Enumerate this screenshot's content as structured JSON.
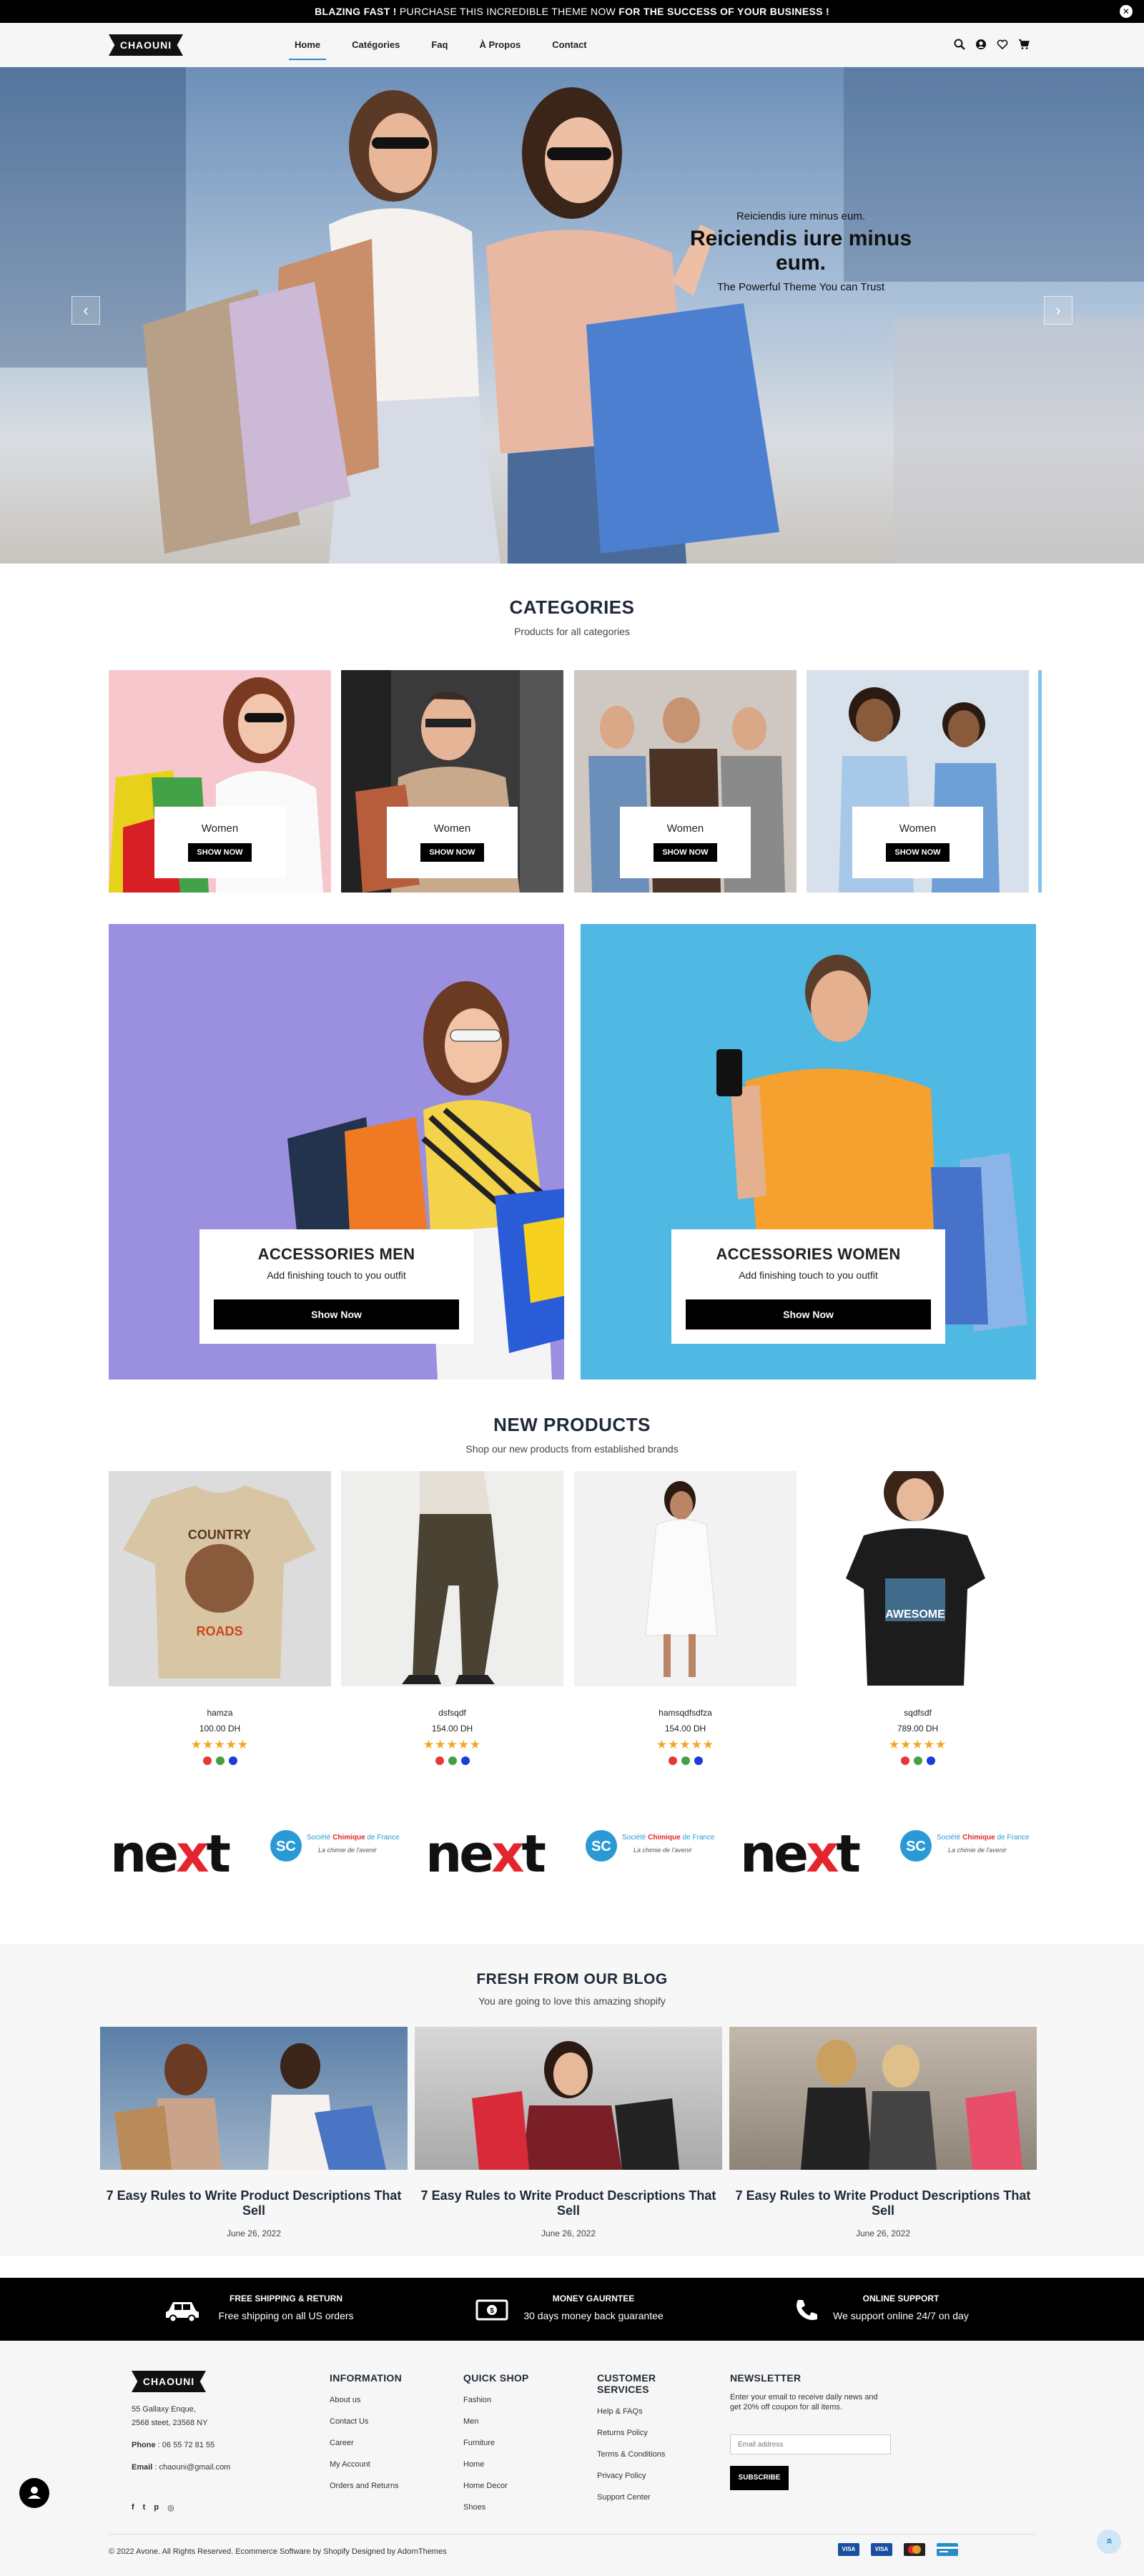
{
  "topbar": {
    "bold1": "BLAZING FAST !",
    "mid": " PURCHASE THIS INCREDIBLE THEME NOW ",
    "bold2": "FOR THE SUCCESS OF YOUR BUSINESS !",
    "close_icon": "close-icon"
  },
  "header": {
    "logo": "CHAOUNI",
    "nav": [
      "Home",
      "Catégories",
      "Faq",
      "À Propos",
      "Contact"
    ],
    "icons": [
      "search-icon",
      "user-icon",
      "heart-icon",
      "cart-icon"
    ]
  },
  "hero": {
    "kicker": "Reiciendis iure minus eum.",
    "title": "Reiciendis iure minus eum.",
    "subtitle": "The Powerful Theme You can Trust",
    "prev": "‹",
    "next": "›"
  },
  "categories": {
    "title": "CATEGORIES",
    "subtitle": "Products for all categories",
    "items": [
      {
        "name": "Women",
        "button": "SHOW NOW"
      },
      {
        "name": "Women",
        "button": "SHOW NOW"
      },
      {
        "name": "Women",
        "button": "SHOW NOW"
      },
      {
        "name": "Women",
        "button": "SHOW NOW"
      }
    ]
  },
  "promos": [
    {
      "title": "ACCESSORIES MEN",
      "subtitle": "Add finishing touch to you outfit",
      "button": "Show Now"
    },
    {
      "title": "ACCESSORIES WOMEN",
      "subtitle": "Add finishing touch to you outfit",
      "button": "Show Now"
    }
  ],
  "new_products": {
    "title": "NEW PRODUCTS",
    "subtitle": "Shop our new products from established brands",
    "items": [
      {
        "name": "hamza",
        "price": "100.00 DH",
        "stars": "★★★★★"
      },
      {
        "name": "dsfsqdf",
        "price": "154.00 DH",
        "stars": "★★★★★"
      },
      {
        "name": "hamsqdfsdfza",
        "price": "154.00 DH",
        "stars": "★★★★★"
      },
      {
        "name": "sqdfsdf",
        "price": "789.00 DH",
        "stars": "★★★★★"
      }
    ],
    "swatch_colors": [
      "#e53935",
      "#43a047",
      "#1e3cd6"
    ]
  },
  "brands": {
    "next": {
      "a": "ne",
      "b": "x",
      "c": "t"
    },
    "sc": {
      "l1a": "Société ",
      "l1b": "Chimique",
      "l1c": " de France",
      "l2": "La chimie de l'avenir"
    }
  },
  "blog": {
    "title": "FRESH FROM OUR BLOG",
    "subtitle": "You are going to love this amazing shopify",
    "posts": [
      {
        "title": "7 Easy Rules to Write Product Descriptions That Sell",
        "date": "June 26, 2022"
      },
      {
        "title": "7 Easy Rules to Write Product Descriptions That Sell",
        "date": "June 26, 2022"
      },
      {
        "title": "7 Easy Rules to Write Product Descriptions That Sell",
        "date": "June 26, 2022"
      }
    ]
  },
  "services": [
    {
      "title": "FREE SHIPPING & RETURN",
      "text": "Free shipping on all US orders",
      "icon": "truck-icon"
    },
    {
      "title": "MONEY GAURNTEE",
      "text": "30 days money back guarantee",
      "icon": "money-icon"
    },
    {
      "title": "ONLINE SUPPORT",
      "text": "We support online 24/7 on day",
      "icon": "phone-icon"
    }
  ],
  "footer": {
    "logo": "CHAOUNI",
    "address1": "55 Gallaxy Enque,",
    "address2": "2568 steet, 23568 NY",
    "phone_label": "Phone",
    "phone": " : 06 55 72 81 55",
    "email_label": "Email",
    "email": " : chaouni@gmail.com",
    "social_icons": [
      "facebook-icon",
      "twitter-icon",
      "pinterest-icon",
      "instagram-icon"
    ],
    "information": {
      "title": "INFORMATION",
      "links": [
        "About us",
        "Contact Us",
        "Career",
        "My Account",
        "Orders and Returns"
      ]
    },
    "quick_shop": {
      "title": "QUICK SHOP",
      "links": [
        "Fashion",
        "Men",
        "Furniture",
        "Home",
        "Home Decor",
        "Shoes"
      ]
    },
    "customer_services": {
      "title1": "CUSTOMER",
      "title2": "SERVICES",
      "links": [
        "Help & FAQs",
        "Returns Policy",
        "Terms & Conditions",
        "Privacy Policy",
        "Support Center"
      ]
    },
    "newsletter": {
      "title": "NEWSLETTER",
      "text1": "Enter your email to receive daily news and",
      "text2": "get 20% off coupon for all items.",
      "placeholder": "Email address",
      "button": "SUBSCRIBE"
    },
    "copyright": "© 2022 Avone. All Rights Reserved. Ecommerce Software by Shopify Designed by AdornThemes",
    "payments": [
      "VISA",
      "VISA",
      "mastercard",
      "card"
    ]
  },
  "colors": {
    "accent": "#2a8bc7",
    "star": "#f5a623",
    "black": "#000000"
  }
}
